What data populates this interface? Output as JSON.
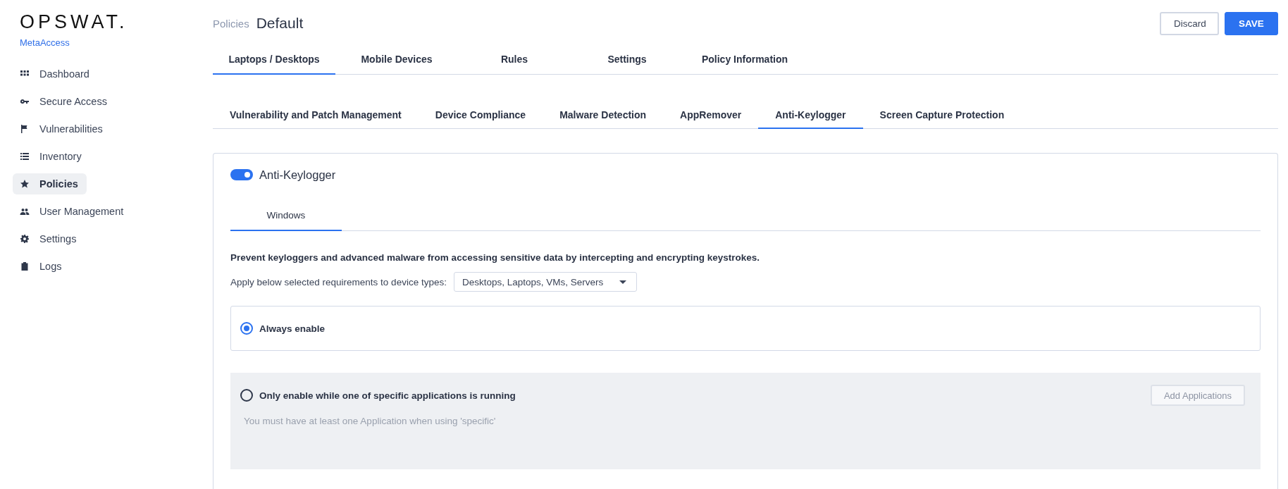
{
  "brand": {
    "logo": "OPSWAT.",
    "product": "MetaAccess"
  },
  "sidebar": {
    "items": [
      {
        "label": "Dashboard",
        "selected": false
      },
      {
        "label": "Secure Access",
        "selected": false
      },
      {
        "label": "Vulnerabilities",
        "selected": false
      },
      {
        "label": "Inventory",
        "selected": false
      },
      {
        "label": "Policies",
        "selected": true
      },
      {
        "label": "User Management",
        "selected": false
      },
      {
        "label": "Settings",
        "selected": false
      },
      {
        "label": "Logs",
        "selected": false
      }
    ]
  },
  "breadcrumb": {
    "parent": "Policies",
    "current": "Default"
  },
  "buttons": [
    {
      "label": "Discard",
      "kind": "secondary"
    },
    {
      "label": "SAVE",
      "kind": "primary"
    }
  ],
  "tabs": [
    {
      "label": "Laptops / Desktops",
      "selected": true
    },
    {
      "label": "Mobile Devices",
      "selected": false
    },
    {
      "label": "Rules",
      "selected": false
    },
    {
      "label": "Settings",
      "selected": false
    },
    {
      "label": "Policy Information",
      "selected": false
    }
  ],
  "subtabs": [
    {
      "label": "Vulnerability and Patch Management",
      "selected": false
    },
    {
      "label": "Device Compliance",
      "selected": false
    },
    {
      "label": "Malware Detection",
      "selected": false
    },
    {
      "label": "AppRemover",
      "selected": false
    },
    {
      "label": "Anti-Keylogger",
      "selected": true
    },
    {
      "label": "Screen Capture Protection",
      "selected": false
    }
  ],
  "section": {
    "title": "Anti-Keylogger",
    "on": true,
    "platform_tabs": [
      {
        "label": "Windows",
        "selected": true
      }
    ],
    "description": "Prevent keyloggers and advanced malware from accessing sensitive data by intercepting and encrypting keystrokes.",
    "device_types": {
      "label": "Apply below selected requirements to device types:",
      "value": "Desktops, Laptops, VMs, Servers"
    },
    "options": [
      {
        "label": "Always enable",
        "selected": true
      },
      {
        "label": "Only enable while one of specific applications is running",
        "selected": false,
        "hint": "You must have at least one Application when using 'specific'",
        "button": {
          "label": "Add Applications",
          "disabled": true
        }
      }
    ]
  }
}
